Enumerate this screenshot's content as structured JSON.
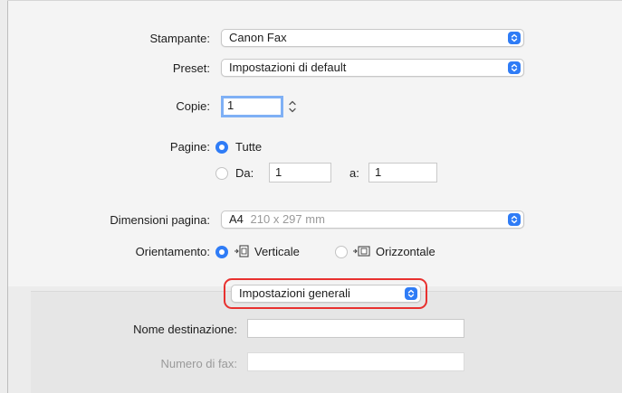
{
  "printer": {
    "label": "Stampante:",
    "value": "Canon Fax"
  },
  "preset": {
    "label": "Preset:",
    "value": "Impostazioni di default"
  },
  "copies": {
    "label": "Copie:",
    "value": "1"
  },
  "pages": {
    "label": "Pagine:",
    "all_label": "Tutte",
    "from_label": "Da:",
    "from_value": "1",
    "to_label": "a:",
    "to_value": "1"
  },
  "paper_size": {
    "label": "Dimensioni pagina:",
    "name": "A4",
    "dims": "210 x 297 mm"
  },
  "orientation": {
    "label": "Orientamento:",
    "portrait_label": "Verticale",
    "landscape_label": "Orizzontale"
  },
  "section": {
    "value": "Impostazioni generali"
  },
  "destination": {
    "label": "Nome destinazione:",
    "value": ""
  },
  "fax_number": {
    "label": "Numero di fax:",
    "value": ""
  },
  "colors": {
    "accent": "#2f7cf6",
    "highlight": "#e8312f"
  },
  "icons": [
    "popup-arrows-icon",
    "stepper-icon",
    "portrait-orientation-icon",
    "landscape-orientation-icon"
  ]
}
